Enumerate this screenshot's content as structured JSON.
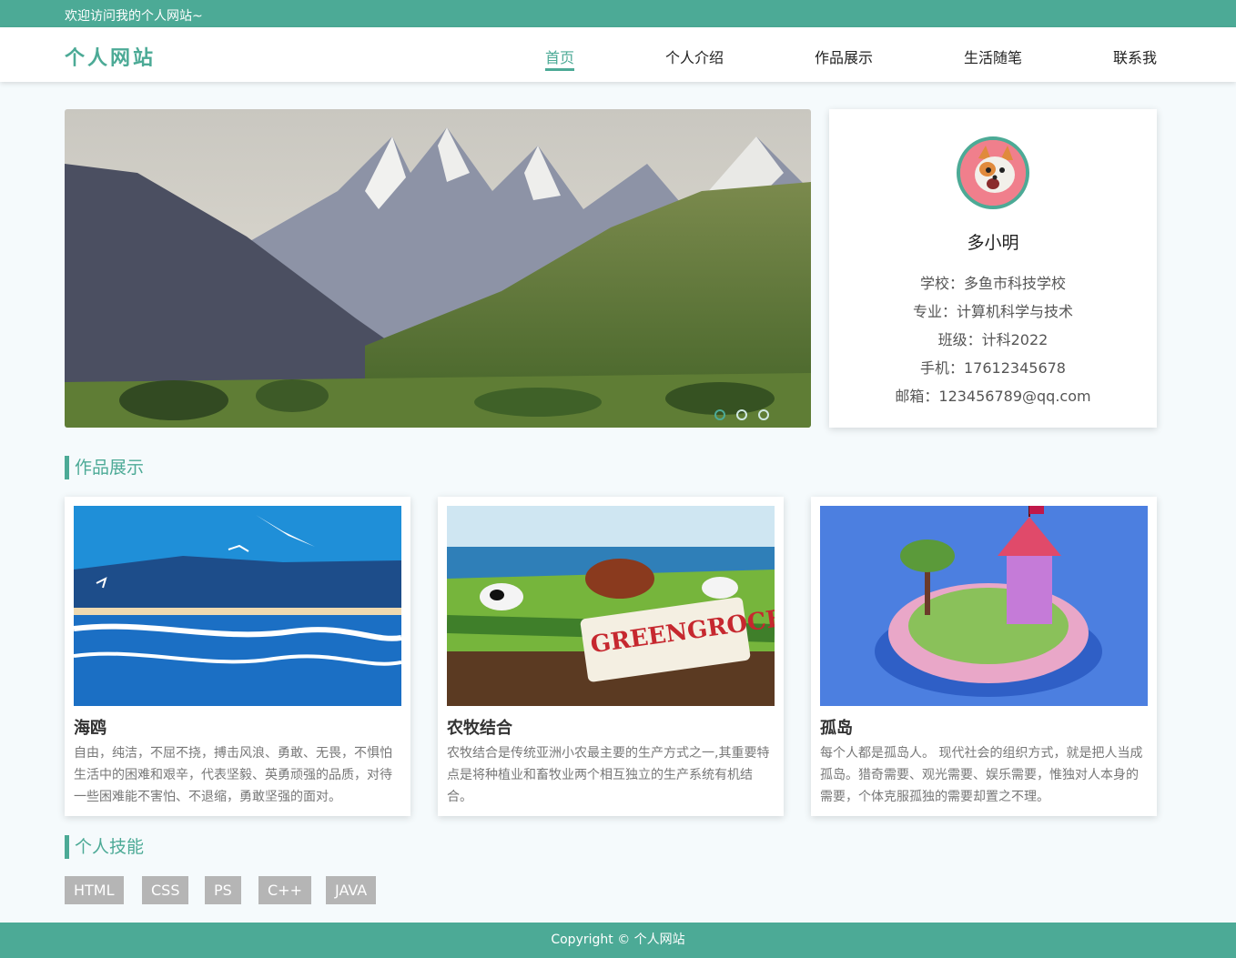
{
  "topbar": {
    "welcome": "欢迎访问我的个人网站~"
  },
  "header": {
    "logo": "个人网站",
    "nav": [
      {
        "label": "首页",
        "active": true
      },
      {
        "label": "个人介绍",
        "active": false
      },
      {
        "label": "作品展示",
        "active": false
      },
      {
        "label": "生活随笔",
        "active": false
      },
      {
        "label": "联系我",
        "active": false
      }
    ]
  },
  "banner": {
    "slide_count": 3,
    "active_slide": 1,
    "image": "mountain-valley-illustration"
  },
  "profile": {
    "avatar": "corgi-dog-avatar",
    "name": "多小明",
    "lines": [
      "学校：多鱼市科技学校",
      "专业：计算机科学与技术",
      "班级：计科2022",
      "手机：17612345678",
      "邮箱：123456789@qq.com"
    ]
  },
  "works": {
    "title": "作品展示",
    "items": [
      {
        "title": "海鸥",
        "image": "seagull-ocean-illustration",
        "desc": "自由，纯洁，不屈不挠，搏击风浪、勇敢、无畏，不惧怕生活中的困难和艰辛，代表坚毅、英勇顽强的品质，对待一些困难能不害怕、不退缩，勇敢坚强的面对。"
      },
      {
        "title": "农牧结合",
        "image": "greengrocers-farm-illustration",
        "desc": "农牧结合是传统亚洲小农最主要的生产方式之一,其重要特点是将种植业和畜牧业两个相互独立的生产系统有机结合。",
        "sign_text": "GREENGROCERS"
      },
      {
        "title": "孤岛",
        "image": "island-tower-illustration",
        "desc": "每个人都是孤岛人。 现代社会的组织方式，就是把人当成孤岛。猎奇需要、观光需要、娱乐需要，惟独对人本身的需要，个体克服孤独的需要却置之不理。"
      }
    ]
  },
  "skills": {
    "title": "个人技能",
    "items": [
      "HTML",
      "CSS",
      "PS",
      "C++",
      "JAVA"
    ]
  },
  "footer": {
    "copyright": "Copyright © 个人网站"
  },
  "colors": {
    "accent": "#4caa96",
    "skill_bg": "#b5b5b5",
    "page_bg": "#f5fafc"
  }
}
